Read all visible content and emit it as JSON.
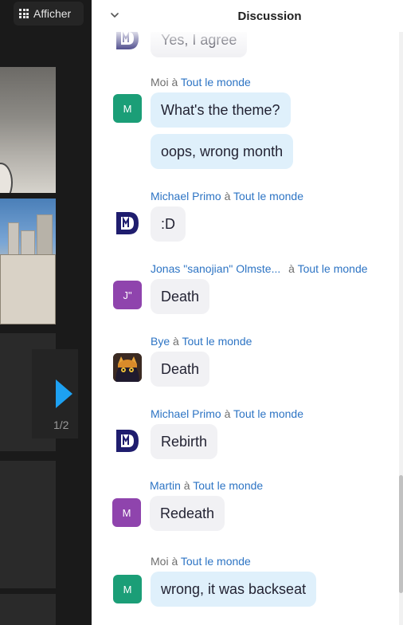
{
  "toolbar": {
    "view_label": "Afficher",
    "view_icon": "grid-icon"
  },
  "pager": {
    "label": "1/2",
    "arrow_icon": "play-arrow-icon",
    "arrow_color": "#1da1f2"
  },
  "chat": {
    "title": "Discussion",
    "collapse_icon": "chevron-down-icon",
    "colors": {
      "link": "#2d74c4",
      "mine_bubble": "#dff0fb",
      "other_bubble": "#f1f1f4",
      "avatar_green": "#1b9e77",
      "avatar_purple": "#8f44ad",
      "dm_logo": "#1f1d6e"
    },
    "separator": "à",
    "top_partial": {
      "text": "Yes, I agree"
    },
    "groups": [
      {
        "sender": "Moi",
        "to": "Tout le monde",
        "avatar": "M",
        "messages": [
          "What's the theme?",
          "oops, wrong month"
        ]
      },
      {
        "sender": "Michael Primo",
        "to": "Tout le monde",
        "avatar": "DM",
        "messages": [
          ":D"
        ]
      },
      {
        "sender": "Jonas \"sanojian\" Olmste...",
        "to": "Tout le monde",
        "avatar": "J\"",
        "messages": [
          "Death"
        ]
      },
      {
        "sender": "Bye",
        "to": "Tout le monde",
        "avatar": "cat",
        "messages": [
          "Death"
        ]
      },
      {
        "sender": "Michael Primo",
        "to": "Tout le monde",
        "avatar": "DM",
        "messages": [
          "Rebirth"
        ]
      },
      {
        "sender": "Martin",
        "to": "Tout le monde",
        "avatar": "M",
        "messages": [
          "Redeath"
        ]
      },
      {
        "sender": "Moi",
        "to": "Tout le monde",
        "avatar": "M",
        "messages": [
          "wrong, it was backseat"
        ]
      }
    ]
  }
}
